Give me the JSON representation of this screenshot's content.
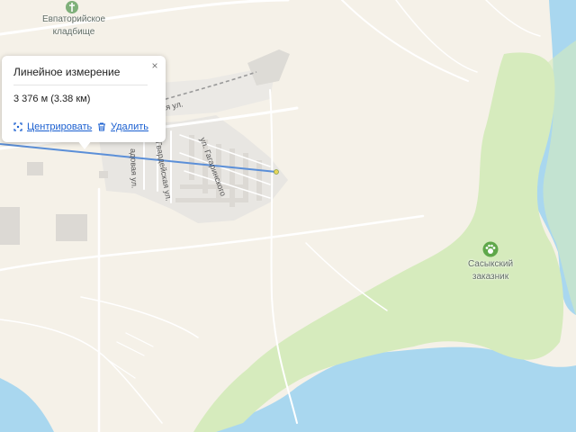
{
  "map": {
    "labels": {
      "cemetery": "Евпаторийское\nкладбище",
      "reserve": "Сасыкский\nзаказник"
    },
    "streets": {
      "s1": "ышевская ул.",
      "s2": "адовая ул.",
      "s3": "Гвардейская ул.",
      "s4": "ул. Гагаринского"
    },
    "icons": {
      "cemetery": "cemetery-pin-icon",
      "reserve": "paw-icon"
    }
  },
  "measurement_popup": {
    "title": "Линейное измерение",
    "distance": "3 376 м (3.38 км)",
    "center_label": "Центрировать",
    "delete_label": "Удалить",
    "close_symbol": "×"
  },
  "colors": {
    "land": "#f5f1e8",
    "water": "#a9d7ef",
    "park": "#d6ebbd",
    "urban": "#e8e6e2",
    "measure_line": "#5b8fd8",
    "link": "#1a5fd0"
  }
}
